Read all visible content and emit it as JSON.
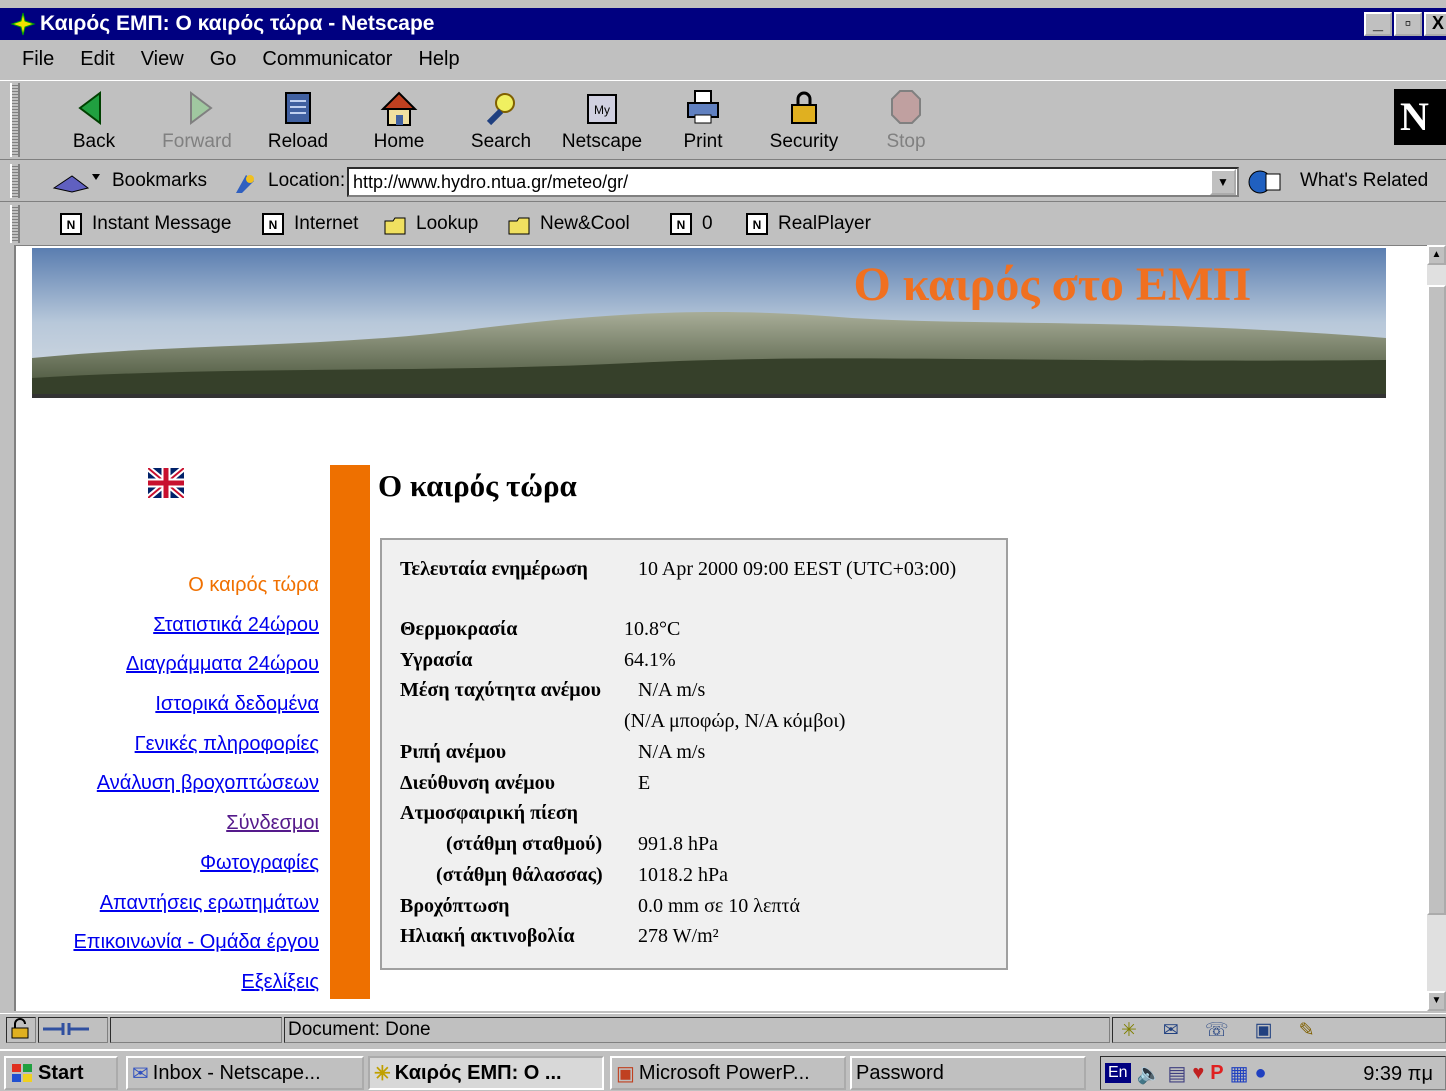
{
  "window": {
    "title": "Καιρός ΕΜΠ: Ο καιρός τώρα - Netscape",
    "buttons": [
      "_",
      "▫",
      "X"
    ]
  },
  "menu": [
    "File",
    "Edit",
    "View",
    "Go",
    "Communicator",
    "Help"
  ],
  "nav_toolbar": {
    "back": "Back",
    "forward": "Forward",
    "reload": "Reload",
    "home": "Home",
    "search": "Search",
    "netscape": "Netscape",
    "print": "Print",
    "security": "Security",
    "stop": "Stop"
  },
  "location_bar": {
    "bookmarks": "Bookmarks",
    "location_label": "Location:",
    "url": "http://www.hydro.ntua.gr/meteo/gr/",
    "whats_related": "What's Related"
  },
  "personal_toolbar": [
    "Instant Message",
    "Internet",
    "Lookup",
    "New&Cool",
    "0",
    "RealPlayer"
  ],
  "page": {
    "banner_title": "Ο καιρός στο ΕΜΠ",
    "heading": "Ο καιρός τώρα",
    "nav_links": [
      "Ο καιρός τώρα",
      "Στατιστικά 24ώρου",
      "Διαγράμματα 24ώρου",
      "Ιστορικά δεδομένα",
      "Γενικές πληροφορίες",
      "Ανάλυση βροχοπτώσεων",
      "Σύνδεσμοι",
      "Φωτογραφίες",
      "Απαντήσεις ερωτημάτων",
      "Επικοινωνία - Ομάδα έργου",
      "Εξελίξεις"
    ],
    "weather": {
      "updated_label": "Τελευταία ενημέρωση",
      "updated_value": "10 Apr 2000 09:00 EEST (UTC+03:00)",
      "temp_label": "Θερμοκρασία",
      "temp_value": "10.8°C",
      "humidity_label": "Υγρασία",
      "humidity_value": "64.1%",
      "wind_label": "Μέση ταχύτητα ανέμου",
      "wind_value": "N/A m/s",
      "wind_extra": "(N/A μποφώρ, N/A κόμβοι)",
      "gust_label": "Ριπή ανέμου",
      "gust_value": "N/A m/s",
      "direction_label": "Διεύθυνση ανέμου",
      "direction_value": "E",
      "pressure_label": "Ατμοσφαιρική πίεση",
      "station_label": "(στάθμη σταθμού)",
      "station_value": "991.8 hPa",
      "sea_label": "(στάθμη θάλασσας)",
      "sea_value": "1018.2 hPa",
      "rain_label": "Βροχόπτωση",
      "rain_value": "0.0 mm σε 10 λεπτά",
      "solar_label": "Ηλιακή ακτινοβολία",
      "solar_value": "278 W/m²"
    }
  },
  "status": {
    "text": "Document: Done"
  },
  "taskbar": {
    "start": "Start",
    "items": [
      "Inbox - Netscape...",
      "Καιρός ΕΜΠ: Ο ...",
      "Microsoft PowerP...",
      "Password"
    ],
    "lang": "En",
    "clock": "9:39 πμ"
  }
}
